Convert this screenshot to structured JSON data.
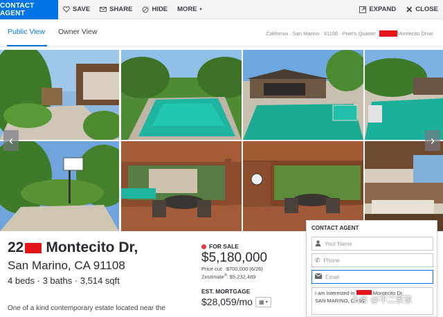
{
  "toolbar": {
    "contact": "CONTACT AGENT",
    "save": "SAVE",
    "share": "SHARE",
    "hide": "HIDE",
    "more": "MORE",
    "expand": "EXPAND",
    "close": "CLOSE"
  },
  "tabs": [
    {
      "label": "Public View"
    },
    {
      "label": "Owner View"
    }
  ],
  "breadcrumb": {
    "city": "California · San Marino · 91108 · Poet's Quarter",
    "street": "Montecito Drive"
  },
  "listing": {
    "address_num": "22",
    "address_street": "Montecito Dr,",
    "address_city": "San Marino, CA 91108",
    "specs": "4 beds · 3 baths · 3,514 sqft",
    "description": "One of a kind contemporary estate located near the",
    "status": "FOR SALE",
    "price": "$5,180,000",
    "price_cut": "Price cut: -$700,000 (6/26)",
    "zestimate_label": "Zestimate",
    "zestimate_value": ": $5,232,489",
    "est_mortgage_label": "EST. MORTGAGE",
    "est_mortgage_value": "$28,059/mo"
  },
  "contact_form": {
    "title": "CONTACT AGENT",
    "name_placeholder": "Your Name",
    "phone_placeholder": "Phone",
    "email_placeholder": "Email",
    "message_line1_a": "I am interested in",
    "message_line1_b": "Montecito Dr,",
    "message_line2": "SAN MARINO, CA 91"
  },
  "watermark": "头条 @不二家茶",
  "colors": {
    "accent": "#0074e4",
    "redaction": "#e8141c",
    "sale_dot": "#e23b3b"
  }
}
